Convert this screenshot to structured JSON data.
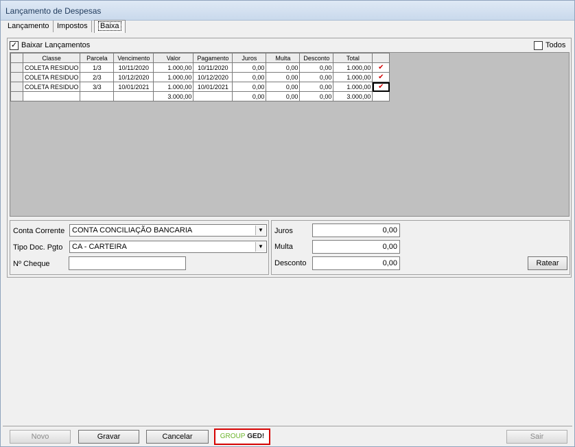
{
  "window": {
    "title": "Lançamento de Despesas"
  },
  "tabs": [
    {
      "label": "Lançamento"
    },
    {
      "label": "Impostos"
    },
    {
      "label": "Baixa"
    }
  ],
  "options": {
    "baixar_label": "Baixar Lançamentos",
    "todos_label": "Todos"
  },
  "grid": {
    "columns": [
      "Classe",
      "Parcela",
      "Vencimento",
      "Valor",
      "Pagamento",
      "Juros",
      "Multa",
      "Desconto",
      "Total"
    ],
    "rows": [
      [
        "COLETA RESIDUO",
        "1/3",
        "10/11/2020",
        "1.000,00",
        "10/11/2020",
        "0,00",
        "0,00",
        "0,00",
        "1.000,00"
      ],
      [
        "COLETA RESIDUO",
        "2/3",
        "10/12/2020",
        "1.000,00",
        "10/12/2020",
        "0,00",
        "0,00",
        "0,00",
        "1.000,00"
      ],
      [
        "COLETA RESIDUO",
        "3/3",
        "10/01/2021",
        "1.000,00",
        "10/01/2021",
        "0,00",
        "0,00",
        "0,00",
        "1.000,00"
      ]
    ],
    "totals": [
      "",
      "",
      "",
      "3.000,00",
      "",
      "0,00",
      "0,00",
      "0,00",
      "3.000,00"
    ]
  },
  "form": {
    "conta_label": "Conta Corrente",
    "conta_value": "CONTA CONCILIAÇÃO BANCARIA",
    "tipo_label": "Tipo Doc. Pgto",
    "tipo_value": "CA - CARTEIRA",
    "cheque_label": "Nº Cheque",
    "cheque_value": "",
    "juros_label": "Juros",
    "juros_value": "0,00",
    "multa_label": "Multa",
    "multa_value": "0,00",
    "desconto_label": "Desconto",
    "desconto_value": "0,00",
    "ratear_label": "Ratear"
  },
  "footer": {
    "novo": "Novo",
    "gravar": "Gravar",
    "cancelar": "Cancelar",
    "logo_group": "GROUP",
    "logo_ged": "GED!",
    "sair": "Sair"
  }
}
